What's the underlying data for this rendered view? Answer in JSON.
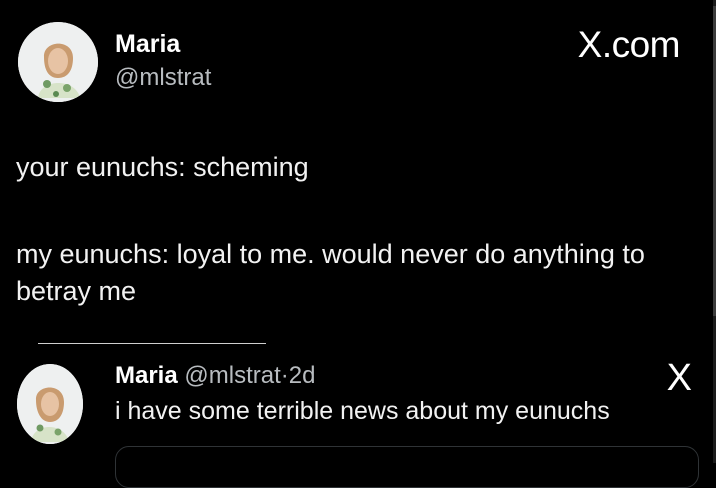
{
  "tweet": {
    "author_name": "Maria",
    "author_handle": "@mlstrat",
    "brand": "X.com",
    "text_line1": "your eunuchs: scheming",
    "text_line2": "my eunuchs: loyal to me. would never do anything to betray me"
  },
  "reply": {
    "author_name": "Maria",
    "author_handle": "@mlstrat",
    "separator": "·",
    "age": "2d",
    "text": "i have some terrible news about my eunuchs",
    "brand": "X"
  },
  "colors": {
    "background": "#000000",
    "text": "#e7e9ea",
    "secondary_text": "#b8bcc0"
  },
  "icons": {
    "avatar": "profile-photo",
    "brand_logo": "x-logo"
  }
}
